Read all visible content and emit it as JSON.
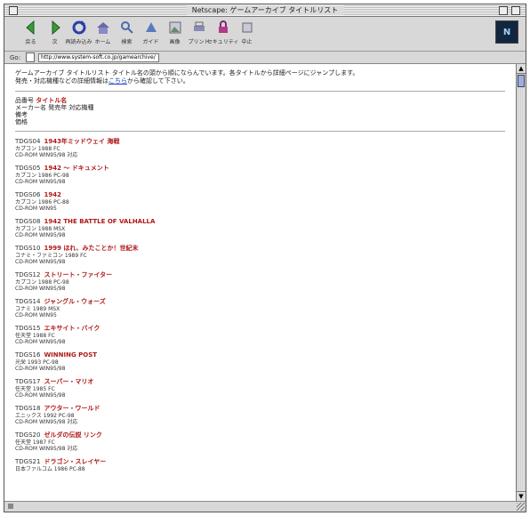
{
  "window": {
    "title": "Netscape: ゲームアーカイブ タイトルリスト"
  },
  "toolbar": {
    "buttons": [
      {
        "label": "戻る",
        "icon": "back-arrow-icon"
      },
      {
        "label": "次",
        "icon": "forward-arrow-icon"
      },
      {
        "label": "再読み込み",
        "icon": "reload-icon"
      },
      {
        "label": "ホーム",
        "icon": "home-icon"
      },
      {
        "label": "検索",
        "icon": "search-icon"
      },
      {
        "label": "ガイド",
        "icon": "guide-icon"
      },
      {
        "label": "画像",
        "icon": "images-icon"
      },
      {
        "label": "プリント",
        "icon": "print-icon"
      },
      {
        "label": "セキュリティ",
        "icon": "security-icon"
      },
      {
        "label": "中止",
        "icon": "stop-icon"
      }
    ],
    "logo": "N"
  },
  "location": {
    "label": "Go:",
    "url": "http://www.system-soft.co.jp/gamearchive/"
  },
  "intro": {
    "line1": "ゲームアーカイブ タイトルリスト タイトル名の頭から順にならんでいます。各タイトルから詳細ページにジャンプします。",
    "line2_prefix": "発売・対応機種などの詳細情報は",
    "link": "こちら",
    "line2_suffix": "から確認して下さい。"
  },
  "legend": {
    "code_label": "品番号",
    "title": "タイトル名",
    "line2": "メーカー名 発売年 対応機種",
    "line3": "備考",
    "line4": "価格"
  },
  "entries": [
    {
      "code": "TDGS04",
      "title": "1943年ミッドウェイ 海戦",
      "l2": "カプコン 1988 FC",
      "l3": "CD-ROM WIN95/98 対応"
    },
    {
      "code": "TDGS05",
      "title": "1942 ～ ドキュメント",
      "l2": "カプコン 1986 PC-98",
      "l3": "CD-ROM WIN95/98"
    },
    {
      "code": "TDGS06",
      "title": "1942",
      "l2": "カプコン 1986 PC-88",
      "l3": "CD-ROM WIN95"
    },
    {
      "code": "TDGS08",
      "title": "1942 THE BATTLE OF VALHALLA",
      "l2": "カプコン 1988 MSX",
      "l3": "CD-ROM WIN95/98"
    },
    {
      "code": "TDGS10",
      "title": "1999 ほれ、みたことか！世紀末",
      "l2": "コナミ・ファミコン 1989 FC",
      "l3": "CD-ROM WIN95/98"
    },
    {
      "code": "TDGS12",
      "title": "ストリート・ファイター",
      "l2": "カプコン 1988 PC-98",
      "l3": "CD-ROM WIN95/98"
    },
    {
      "code": "TDGS14",
      "title": "ジャングル・ウォーズ",
      "l2": "コナミ 1989 MSX",
      "l3": "CD-ROM WIN95"
    },
    {
      "code": "TDGS15",
      "title": "エキサイト・バイク",
      "l2": "任天堂 1988 FC",
      "l3": "CD-ROM WIN95/98"
    },
    {
      "code": "TDGS16",
      "title": "WINNING POST",
      "l2": "光栄 1993 PC-98",
      "l3": "CD-ROM WIN95/98"
    },
    {
      "code": "TDGS17",
      "title": "スーパー・マリオ",
      "l2": "任天堂 1985 FC",
      "l3": "CD-ROM WIN95/98"
    },
    {
      "code": "TDGS18",
      "title": "アウター・ワールド",
      "l2": "エニックス 1992 PC-98",
      "l3": "CD-ROM WIN95/98 対応"
    },
    {
      "code": "TDGS20",
      "title": "ゼルダの伝説 リンク",
      "l2": "任天堂 1987 FC",
      "l3": "CD-ROM WIN95/98 対応"
    },
    {
      "code": "TDGS21",
      "title": "ドラゴン・スレイヤー",
      "l2": "日本ファルコム 1986 PC-88",
      "l3": ""
    }
  ]
}
